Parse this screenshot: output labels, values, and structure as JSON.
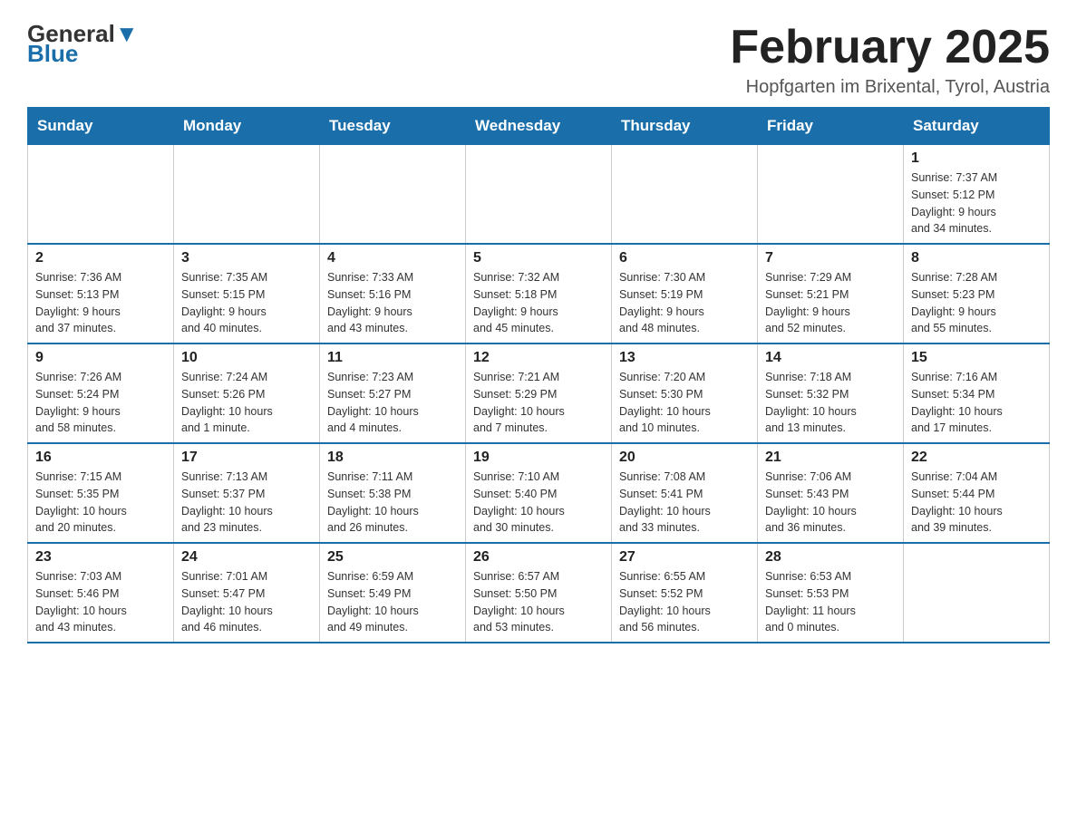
{
  "logo": {
    "general": "General",
    "blue": "Blue",
    "triangle": "▼"
  },
  "header": {
    "title": "February 2025",
    "location": "Hopfgarten im Brixental, Tyrol, Austria"
  },
  "weekdays": [
    "Sunday",
    "Monday",
    "Tuesday",
    "Wednesday",
    "Thursday",
    "Friday",
    "Saturday"
  ],
  "weeks": [
    [
      {
        "day": "",
        "detail": ""
      },
      {
        "day": "",
        "detail": ""
      },
      {
        "day": "",
        "detail": ""
      },
      {
        "day": "",
        "detail": ""
      },
      {
        "day": "",
        "detail": ""
      },
      {
        "day": "",
        "detail": ""
      },
      {
        "day": "1",
        "detail": "Sunrise: 7:37 AM\nSunset: 5:12 PM\nDaylight: 9 hours\nand 34 minutes."
      }
    ],
    [
      {
        "day": "2",
        "detail": "Sunrise: 7:36 AM\nSunset: 5:13 PM\nDaylight: 9 hours\nand 37 minutes."
      },
      {
        "day": "3",
        "detail": "Sunrise: 7:35 AM\nSunset: 5:15 PM\nDaylight: 9 hours\nand 40 minutes."
      },
      {
        "day": "4",
        "detail": "Sunrise: 7:33 AM\nSunset: 5:16 PM\nDaylight: 9 hours\nand 43 minutes."
      },
      {
        "day": "5",
        "detail": "Sunrise: 7:32 AM\nSunset: 5:18 PM\nDaylight: 9 hours\nand 45 minutes."
      },
      {
        "day": "6",
        "detail": "Sunrise: 7:30 AM\nSunset: 5:19 PM\nDaylight: 9 hours\nand 48 minutes."
      },
      {
        "day": "7",
        "detail": "Sunrise: 7:29 AM\nSunset: 5:21 PM\nDaylight: 9 hours\nand 52 minutes."
      },
      {
        "day": "8",
        "detail": "Sunrise: 7:28 AM\nSunset: 5:23 PM\nDaylight: 9 hours\nand 55 minutes."
      }
    ],
    [
      {
        "day": "9",
        "detail": "Sunrise: 7:26 AM\nSunset: 5:24 PM\nDaylight: 9 hours\nand 58 minutes."
      },
      {
        "day": "10",
        "detail": "Sunrise: 7:24 AM\nSunset: 5:26 PM\nDaylight: 10 hours\nand 1 minute."
      },
      {
        "day": "11",
        "detail": "Sunrise: 7:23 AM\nSunset: 5:27 PM\nDaylight: 10 hours\nand 4 minutes."
      },
      {
        "day": "12",
        "detail": "Sunrise: 7:21 AM\nSunset: 5:29 PM\nDaylight: 10 hours\nand 7 minutes."
      },
      {
        "day": "13",
        "detail": "Sunrise: 7:20 AM\nSunset: 5:30 PM\nDaylight: 10 hours\nand 10 minutes."
      },
      {
        "day": "14",
        "detail": "Sunrise: 7:18 AM\nSunset: 5:32 PM\nDaylight: 10 hours\nand 13 minutes."
      },
      {
        "day": "15",
        "detail": "Sunrise: 7:16 AM\nSunset: 5:34 PM\nDaylight: 10 hours\nand 17 minutes."
      }
    ],
    [
      {
        "day": "16",
        "detail": "Sunrise: 7:15 AM\nSunset: 5:35 PM\nDaylight: 10 hours\nand 20 minutes."
      },
      {
        "day": "17",
        "detail": "Sunrise: 7:13 AM\nSunset: 5:37 PM\nDaylight: 10 hours\nand 23 minutes."
      },
      {
        "day": "18",
        "detail": "Sunrise: 7:11 AM\nSunset: 5:38 PM\nDaylight: 10 hours\nand 26 minutes."
      },
      {
        "day": "19",
        "detail": "Sunrise: 7:10 AM\nSunset: 5:40 PM\nDaylight: 10 hours\nand 30 minutes."
      },
      {
        "day": "20",
        "detail": "Sunrise: 7:08 AM\nSunset: 5:41 PM\nDaylight: 10 hours\nand 33 minutes."
      },
      {
        "day": "21",
        "detail": "Sunrise: 7:06 AM\nSunset: 5:43 PM\nDaylight: 10 hours\nand 36 minutes."
      },
      {
        "day": "22",
        "detail": "Sunrise: 7:04 AM\nSunset: 5:44 PM\nDaylight: 10 hours\nand 39 minutes."
      }
    ],
    [
      {
        "day": "23",
        "detail": "Sunrise: 7:03 AM\nSunset: 5:46 PM\nDaylight: 10 hours\nand 43 minutes."
      },
      {
        "day": "24",
        "detail": "Sunrise: 7:01 AM\nSunset: 5:47 PM\nDaylight: 10 hours\nand 46 minutes."
      },
      {
        "day": "25",
        "detail": "Sunrise: 6:59 AM\nSunset: 5:49 PM\nDaylight: 10 hours\nand 49 minutes."
      },
      {
        "day": "26",
        "detail": "Sunrise: 6:57 AM\nSunset: 5:50 PM\nDaylight: 10 hours\nand 53 minutes."
      },
      {
        "day": "27",
        "detail": "Sunrise: 6:55 AM\nSunset: 5:52 PM\nDaylight: 10 hours\nand 56 minutes."
      },
      {
        "day": "28",
        "detail": "Sunrise: 6:53 AM\nSunset: 5:53 PM\nDaylight: 11 hours\nand 0 minutes."
      },
      {
        "day": "",
        "detail": ""
      }
    ]
  ]
}
